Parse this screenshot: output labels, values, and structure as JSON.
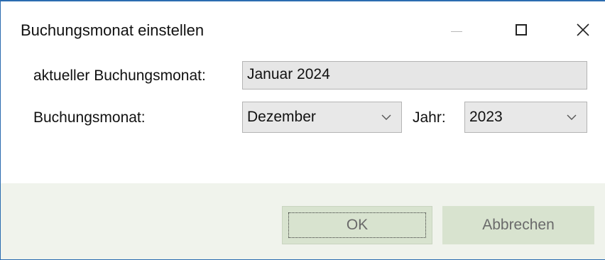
{
  "window": {
    "title": "Buchungsmonat einstellen",
    "controls": {
      "minimize_icon": "minimize-icon",
      "maximize_icon": "maximize-icon",
      "close_icon": "close-icon",
      "close_glyph": "✕"
    }
  },
  "form": {
    "current_month_label": "aktueller Buchungsmonat:",
    "current_month_value": "Januar 2024",
    "month_label": "Buchungsmonat:",
    "month_selected": "Dezember",
    "year_label": "Jahr:",
    "year_selected": "2023"
  },
  "buttons": {
    "ok_label": "OK",
    "cancel_label": "Abbrechen"
  },
  "colors": {
    "window_border": "#2b6cb0",
    "footer_bg": "#f0f3ec",
    "button_bg": "#d8e3cf",
    "field_bg": "#e6e6e6"
  }
}
